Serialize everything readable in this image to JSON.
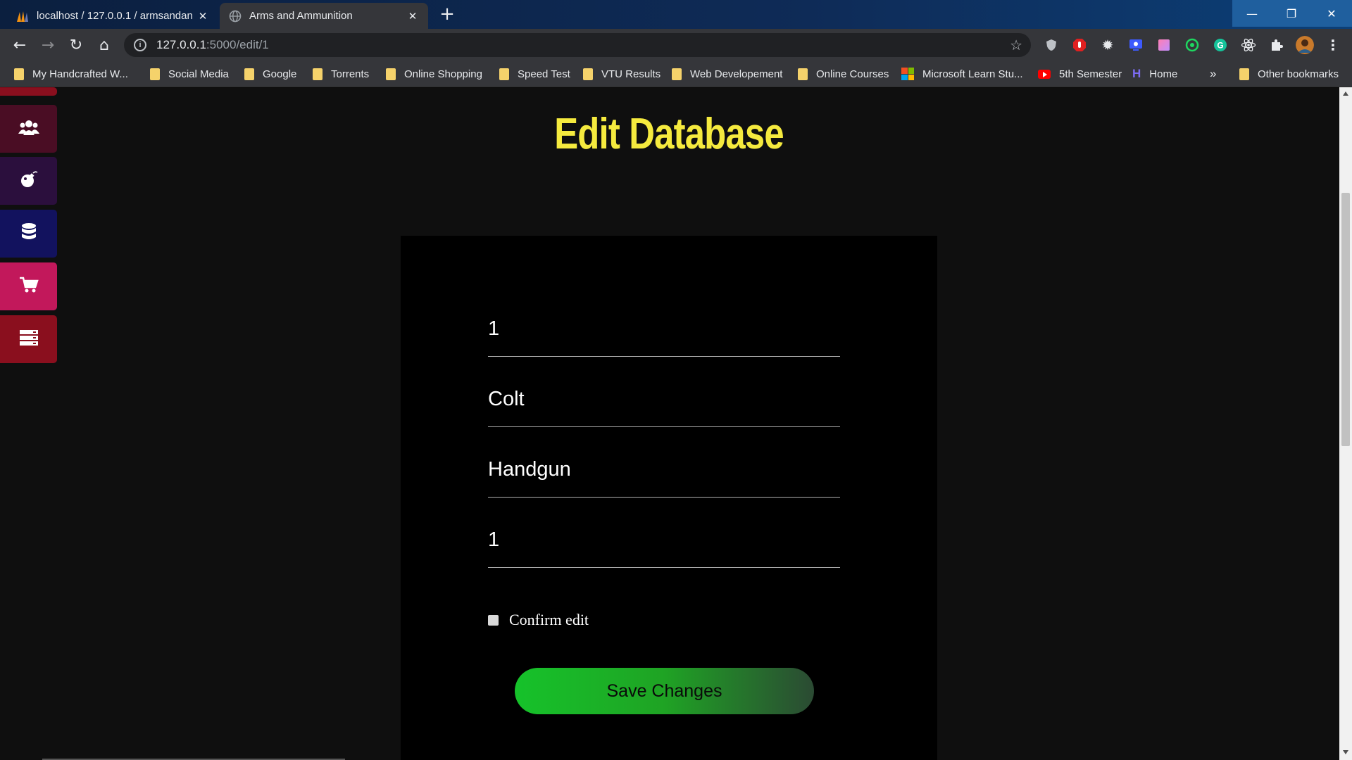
{
  "browser": {
    "tabs": [
      {
        "title": "localhost / 127.0.0.1 / armsandan",
        "active": false,
        "favicon": "phpmyadmin-icon"
      },
      {
        "title": "Arms and Ammunition",
        "active": true,
        "favicon": "globe-icon"
      }
    ],
    "new_tab_symbol": "+",
    "window_controls": {
      "minimize": "—",
      "restore": "❐",
      "close": "✕"
    },
    "address": {
      "host": "127.0.0.1",
      "path": ":5000/edit/1"
    },
    "nav": {
      "back": "←",
      "forward": "→",
      "reload": "↻",
      "home": "⌂"
    },
    "star_symbol": "☆",
    "bookmarks": [
      {
        "label": "My Handcrafted W...",
        "icon": "folder-icon"
      },
      {
        "label": "Social Media",
        "icon": "folder-icon"
      },
      {
        "label": "Google",
        "icon": "folder-icon"
      },
      {
        "label": "Torrents",
        "icon": "folder-icon"
      },
      {
        "label": "Online Shopping",
        "icon": "folder-icon"
      },
      {
        "label": "Speed Test",
        "icon": "folder-icon"
      },
      {
        "label": "VTU Results",
        "icon": "folder-icon"
      },
      {
        "label": "Web Developement",
        "icon": "folder-icon"
      },
      {
        "label": "Online Courses",
        "icon": "folder-icon"
      },
      {
        "label": "Microsoft Learn Stu...",
        "icon": "microsoft-icon"
      },
      {
        "label": "5th Semester",
        "icon": "youtube-icon"
      },
      {
        "label": "Home",
        "icon": "h-logo-icon"
      }
    ],
    "bookmarks_overflow": "»",
    "other_bookmarks": "Other bookmarks"
  },
  "sidebar": {
    "items": [
      {
        "icon": "users-icon",
        "color": "#4a0d24"
      },
      {
        "icon": "bomb-icon",
        "color": "#2b0f3d"
      },
      {
        "icon": "database-icon",
        "color": "#12125e"
      },
      {
        "icon": "cart-icon",
        "color": "#c2185b"
      },
      {
        "icon": "server-icon",
        "color": "#8a0f1e"
      }
    ]
  },
  "page": {
    "title": "Edit Database",
    "title_color": "#f5ea3e",
    "fields": [
      {
        "value": "1"
      },
      {
        "value": "Colt"
      },
      {
        "value": "Handgun"
      },
      {
        "value": "1"
      }
    ],
    "confirm_label": "Confirm edit",
    "confirm_checked": false,
    "save_label": "Save Changes"
  }
}
